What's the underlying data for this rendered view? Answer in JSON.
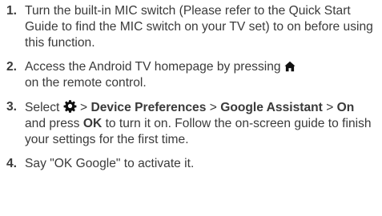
{
  "steps": [
    {
      "number": "1.",
      "text": "Turn the built-in MIC switch (Please refer to the Quick Start Guide to find the MIC switch on your TV set) to on before using this function."
    },
    {
      "number": "2.",
      "text_before_icon": "Access the Android TV homepage by pressing",
      "icon": "home-icon",
      "text_after_icon": "on the remote control."
    },
    {
      "number": "3.",
      "select": "Select",
      "icon": "gear-icon",
      "sep1": ">",
      "device_preferences": "Device Preferences",
      "sep2": ">",
      "google_assistant": "Google Assistant",
      "sep3": ">",
      "on": "On",
      "and_press": "and press",
      "ok": "OK",
      "rest": "to turn it on. Follow the on-screen guide to finish your settings for the first time."
    },
    {
      "number": "4.",
      "text": "Say \"OK Google\" to activate it."
    }
  ]
}
